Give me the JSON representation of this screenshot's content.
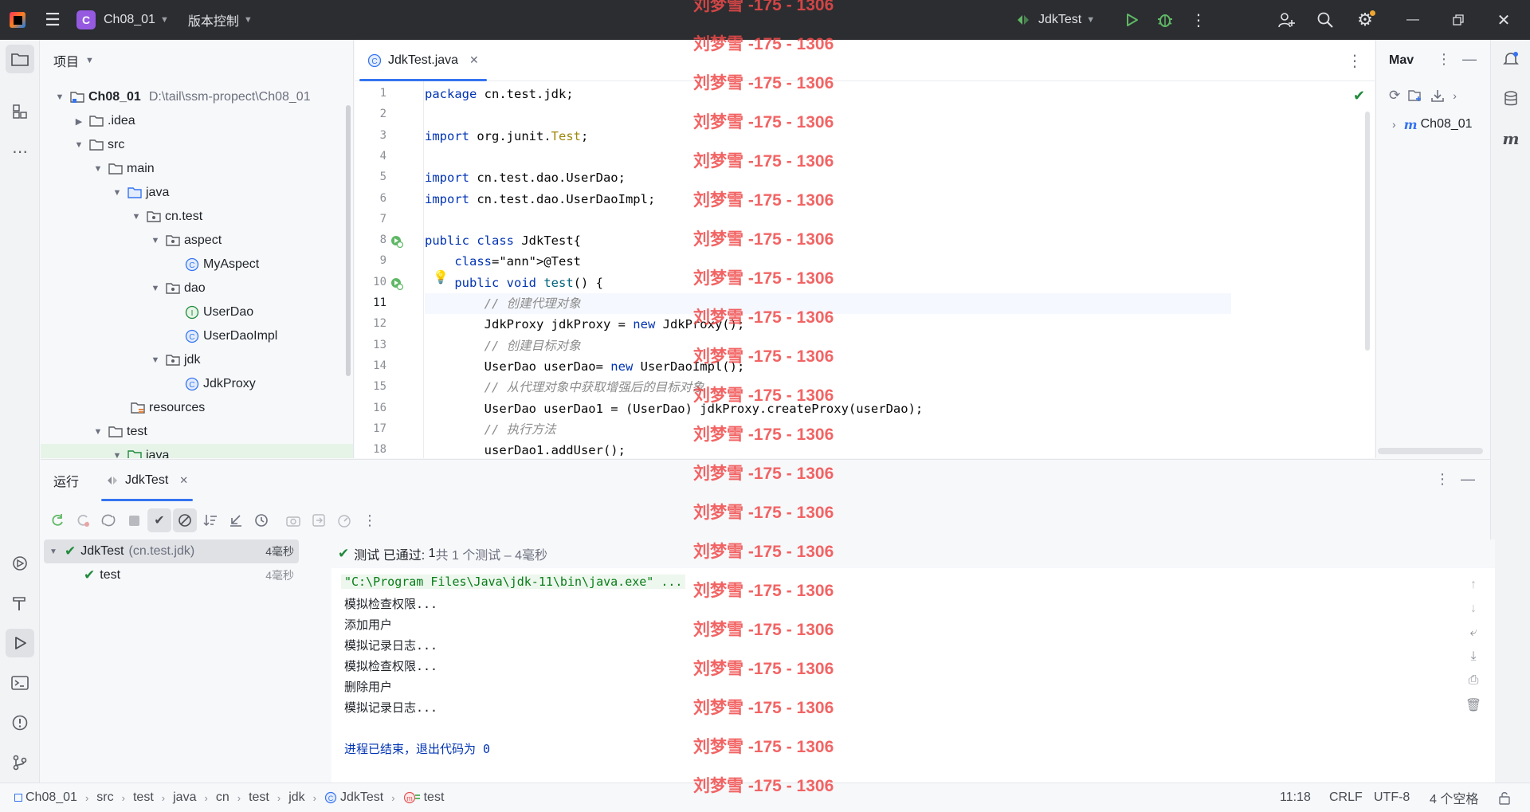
{
  "titlebar": {
    "project_letter": "C",
    "project_name": "Ch08_01",
    "vcs_label": "版本控制",
    "run_config": "JdkTest"
  },
  "project_panel": {
    "title": "项目",
    "root_name": "Ch08_01",
    "root_path": "D:\\tail\\ssm-propect\\Ch08_01",
    "items": [
      {
        "label": "Ch08_01",
        "level": 0,
        "icon": "folder-icon",
        "expanded": true
      },
      {
        "label": ".idea",
        "level": 1,
        "icon": "folder-icon",
        "expanded": false
      },
      {
        "label": "src",
        "level": 1,
        "icon": "folder-icon",
        "expanded": true
      },
      {
        "label": "main",
        "level": 2,
        "icon": "folder-icon",
        "expanded": true
      },
      {
        "label": "java",
        "level": 3,
        "icon": "source-folder-icon",
        "expanded": true
      },
      {
        "label": "cn.test",
        "level": 4,
        "icon": "package-icon",
        "expanded": true
      },
      {
        "label": "aspect",
        "level": 5,
        "icon": "package-icon",
        "expanded": true
      },
      {
        "label": "MyAspect",
        "level": 6,
        "icon": "class-icon"
      },
      {
        "label": "dao",
        "level": 5,
        "icon": "package-icon",
        "expanded": true
      },
      {
        "label": "UserDao",
        "level": 6,
        "icon": "interface-icon"
      },
      {
        "label": "UserDaoImpl",
        "level": 6,
        "icon": "class-icon"
      },
      {
        "label": "jdk",
        "level": 5,
        "icon": "package-icon",
        "expanded": true
      },
      {
        "label": "JdkProxy",
        "level": 6,
        "icon": "class-icon"
      },
      {
        "label": "resources",
        "level": 3,
        "icon": "resources-folder-icon"
      },
      {
        "label": "test",
        "level": 2,
        "icon": "folder-icon",
        "expanded": true
      },
      {
        "label": "java",
        "level": 3,
        "icon": "test-folder-icon",
        "expanded": true
      }
    ]
  },
  "editor": {
    "tab_label": "JdkTest.java",
    "current_line": 11,
    "lines": [
      "package cn.test.jdk;",
      "",
      "import org.junit.Test;",
      "",
      "import cn.test.dao.UserDao;",
      "import cn.test.dao.UserDaoImpl;",
      "",
      "public class JdkTest{",
      "    @Test",
      "    public void test() {",
      "        // 创建代理对象",
      "        JdkProxy jdkProxy = new JdkProxy();",
      "        // 创建目标对象",
      "        UserDao userDao= new UserDaoImpl();",
      "        // 从代理对象中获取增强后的目标对象",
      "        UserDao userDao1 = (UserDao) jdkProxy.createProxy(userDao);",
      "        // 执行方法",
      "        userDao1.addUser();"
    ]
  },
  "maven_panel": {
    "title": "Mav",
    "item": "Ch08_01"
  },
  "run_panel": {
    "title": "运行",
    "tab_label": "JdkTest",
    "tree": [
      {
        "label": "JdkTest",
        "sub": "(cn.test.jdk)",
        "time": "4毫秒"
      },
      {
        "label": "test",
        "sub": "",
        "time": "4毫秒"
      }
    ],
    "summary_prefix": "测试 已通过: ",
    "summary_count": "1",
    "summary_suffix": "共 1 个测试 – 4毫秒",
    "console": [
      "\"C:\\Program Files\\Java\\jdk-11\\bin\\java.exe\" ...",
      "模拟检查权限...",
      "添加用户",
      "模拟记录日志...",
      "模拟检查权限...",
      "删除用户",
      "模拟记录日志...",
      "",
      "进程已结束，退出代码为 0"
    ]
  },
  "statusbar": {
    "crumbs": [
      "Ch08_01",
      "src",
      "test",
      "java",
      "cn",
      "test",
      "jdk",
      "JdkTest",
      "test"
    ],
    "position": "11:18",
    "line_sep": "CRLF",
    "encoding": "UTF-8",
    "indent": "4 个空格"
  },
  "watermark": {
    "text": "刘梦雪 -175 - 1306",
    "count": 21
  },
  "colors": {
    "accent": "#3574f0",
    "green": "#208a3c",
    "titlebar": "#2b2d30",
    "watermark": "#f04a4a"
  }
}
